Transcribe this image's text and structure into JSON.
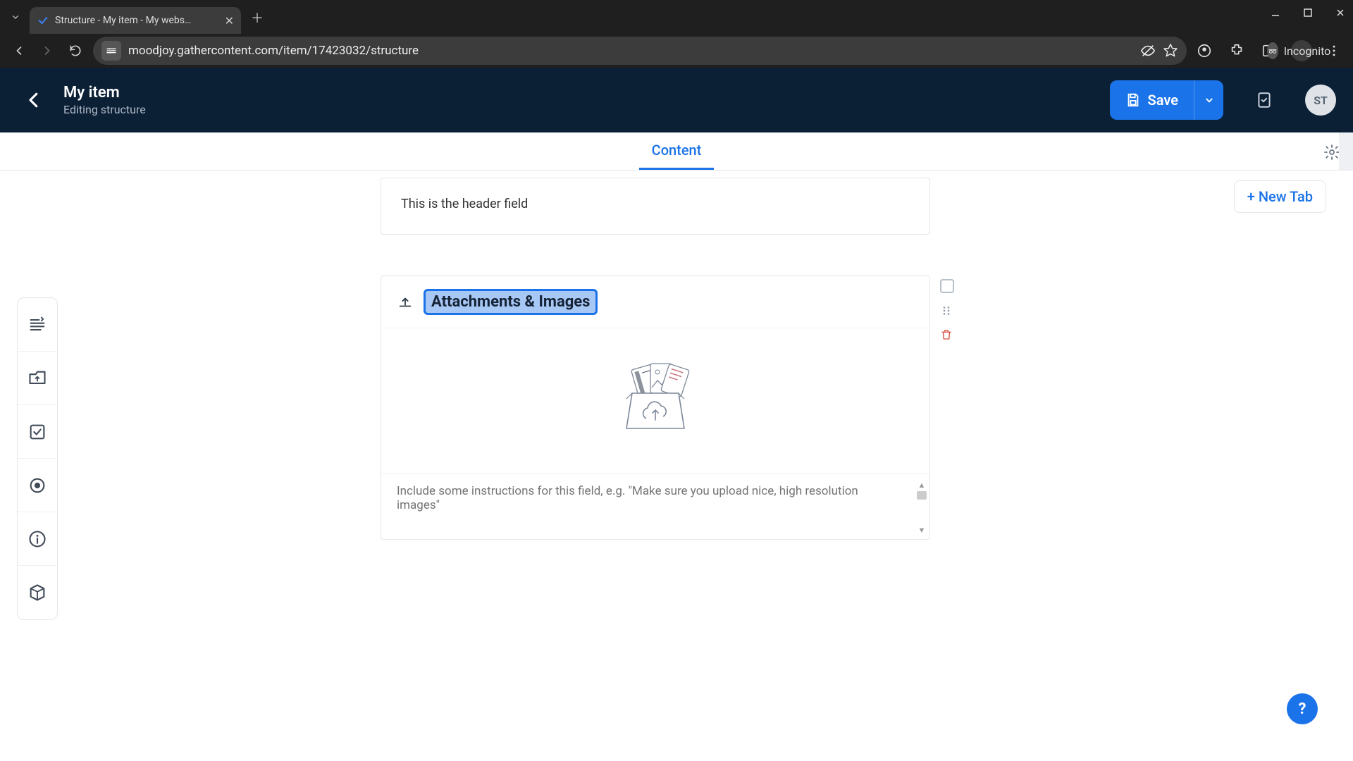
{
  "browser": {
    "tab_title": "Structure - My item - My webs…",
    "url": "moodjoy.gathercontent.com/item/17423032/structure",
    "incognito_label": "Incognito"
  },
  "header": {
    "item_title": "My item",
    "subtitle": "Editing structure",
    "save_label": "Save",
    "avatar_initials": "ST"
  },
  "tabs": {
    "active": "Content",
    "new_tab_label": "+ New Tab"
  },
  "fields": {
    "header_field_text": "This is the header field",
    "attachment_label": "Attachments & Images",
    "instructions_placeholder": "Include some instructions for this field, e.g. \"Make sure you upload nice, high resolution images\""
  },
  "help": {
    "label": "?"
  }
}
